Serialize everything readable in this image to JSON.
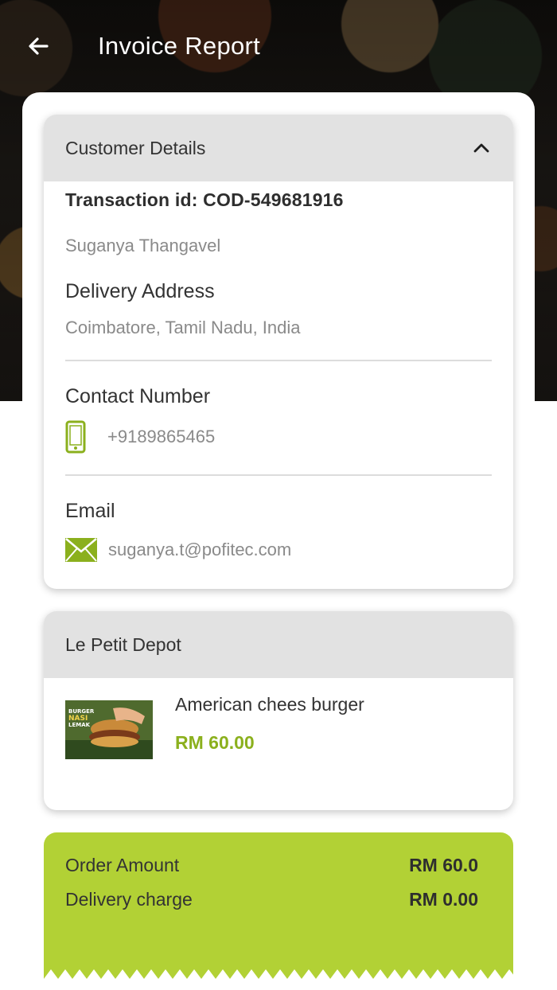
{
  "header": {
    "title": "Invoice Report"
  },
  "customer": {
    "section_title": "Customer Details",
    "transaction_id": "Transaction id: COD-549681916",
    "name": "Suganya Thangavel",
    "delivery_label": "Delivery Address",
    "delivery_address": "Coimbatore, Tamil Nadu, India",
    "contact_label": "Contact Number",
    "phone": "+9189865465",
    "email_label": "Email",
    "email": "suganya.t@pofitec.com"
  },
  "restaurant": {
    "name": "Le Petit Depot",
    "items": [
      {
        "name": "American chees burger",
        "price": "RM 60.00",
        "image_text": "BURGER NASI LEMAK"
      }
    ]
  },
  "summary": {
    "order_amount_label": "Order Amount",
    "order_amount": "RM 60.0",
    "delivery_label": "Delivery charge",
    "delivery_charge": "RM 0.00"
  },
  "colors": {
    "accent": "#b2d135",
    "price": "#8bb01d",
    "icon": "#8bb01d"
  },
  "icons": {
    "back": "arrow-left-icon",
    "collapse": "chevron-up-icon",
    "phone": "phone-icon",
    "email": "mail-icon"
  }
}
